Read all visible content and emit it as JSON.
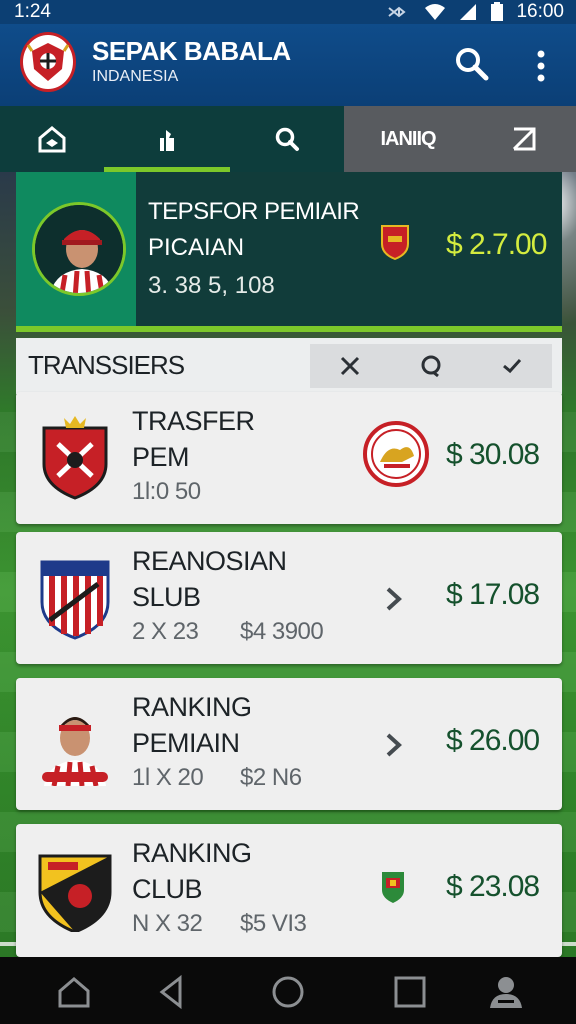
{
  "status_bar": {
    "time_left": "1:24",
    "time_right": "16:00"
  },
  "app": {
    "title": "SEPAK BABALA",
    "subtitle": "INDANESIA"
  },
  "tabs": [
    {
      "icon": "home-icon"
    },
    {
      "icon": "trophy-icon",
      "active": true
    },
    {
      "icon": "search-icon"
    },
    {
      "label": "IANIIQ"
    },
    {
      "icon": "swap-icon"
    }
  ],
  "featured": {
    "title": "TEPSFOR PEMIAIR",
    "line2": "PICAIAN",
    "line3": "3. 38 5, 108",
    "price": "$ 2.7.00"
  },
  "transfers": {
    "title": "TRANSSIERS",
    "filters": [
      "close-icon",
      "comment-icon",
      "check-icon"
    ]
  },
  "list": [
    {
      "title1": "TRASFER",
      "title2": "PEM",
      "meta": "1l:0 50",
      "meta2": "",
      "price": "$ 30.08",
      "action": "club-badge-icon"
    },
    {
      "title1": "REANOSIAN",
      "title2": "SLUB",
      "meta": "2 X 23",
      "meta2": "$4 3900",
      "price": "$ 17.08",
      "action": "chevron-right-icon"
    },
    {
      "title1": "RANKING",
      "title2": "PEMIAIN",
      "meta": "1l X 20",
      "meta2": "$2 N6",
      "price": "$ 26.00",
      "action": "chevron-right-icon"
    },
    {
      "title1": "RANKING",
      "title2": "CLUB",
      "meta": "N X 32",
      "meta2": "$5 VI3",
      "price": "$ 23.08",
      "action": "shield-icon"
    }
  ],
  "colors": {
    "appbar": "#0f4c8a",
    "accent": "#7cc82a",
    "price_featured": "#d4ec3f",
    "price": "#15512d"
  }
}
